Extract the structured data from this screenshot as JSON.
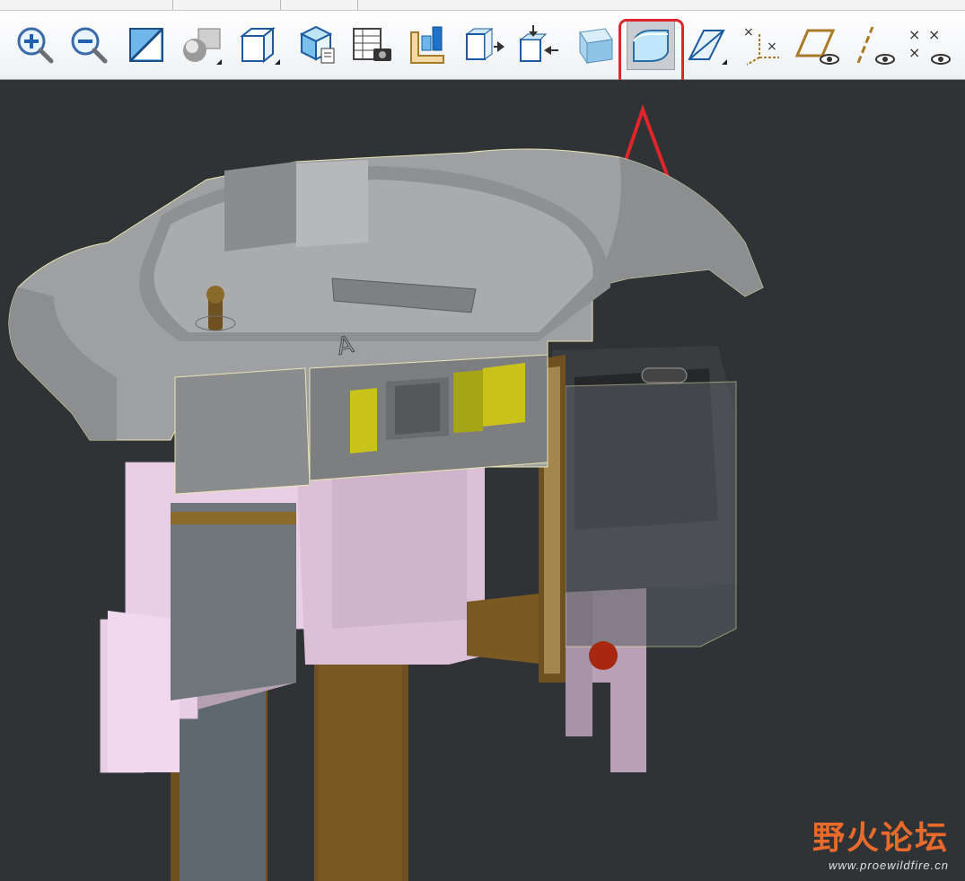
{
  "toolbar": {
    "buttons": [
      {
        "name": "zoom-in-icon"
      },
      {
        "name": "zoom-out-icon"
      },
      {
        "name": "refit-icon"
      },
      {
        "name": "shading-icon"
      },
      {
        "name": "display-style-icon"
      },
      {
        "name": "saved-views-icon"
      },
      {
        "name": "view-manager-icon"
      },
      {
        "name": "layers-icon"
      },
      {
        "name": "orient-icon"
      },
      {
        "name": "repaint-icon"
      },
      {
        "name": "transparent-view-icon"
      },
      {
        "name": "section-cap-icon",
        "active": true
      },
      {
        "name": "datum-display-icon"
      },
      {
        "name": "csys-display-icon"
      },
      {
        "name": "plane-display-icon"
      },
      {
        "name": "axis-display-icon"
      },
      {
        "name": "point-display-icon"
      }
    ]
  },
  "annotation": {
    "highlight_color": "#e0262a",
    "arrow_color": "#e0262a"
  },
  "watermark": {
    "title": "野火论坛",
    "url": "www.proewildfire.cn"
  },
  "colors": {
    "viewport_bg": "#2f3336",
    "part_gray": "#a9a9a9",
    "pink": "#e9cfe6",
    "brown": "#6f5121",
    "yellow": "#c9c21a",
    "red": "#a8280f"
  }
}
